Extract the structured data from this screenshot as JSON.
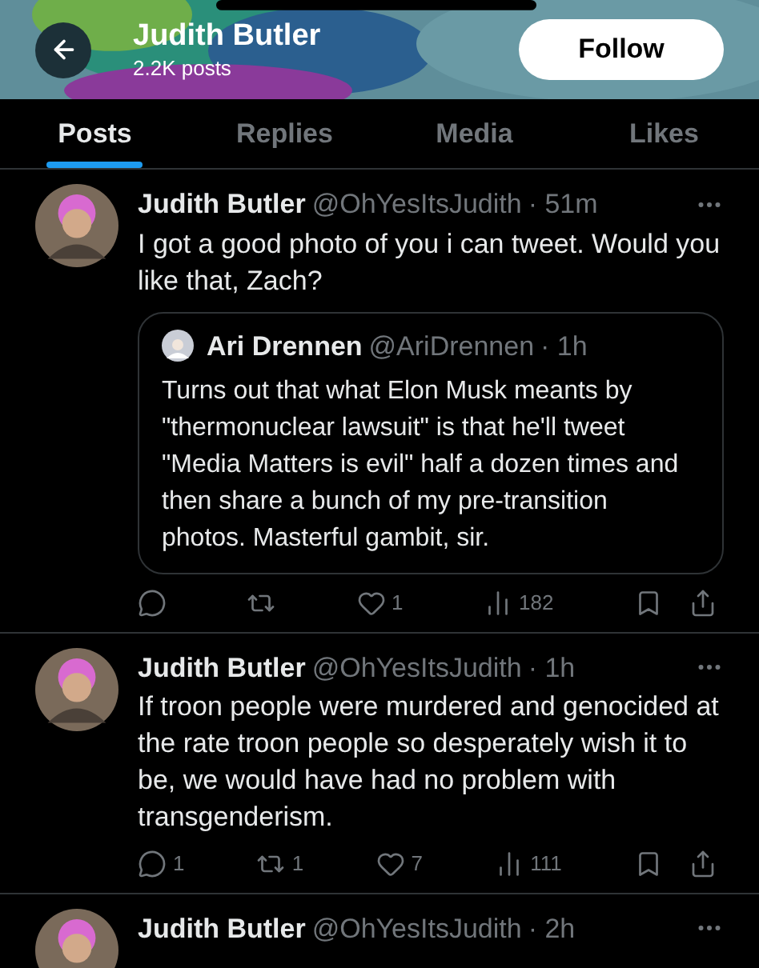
{
  "header": {
    "name": "Judith Butler",
    "post_count": "2.2K posts",
    "follow_label": "Follow"
  },
  "tabs": [
    {
      "label": "Posts",
      "selected": true
    },
    {
      "label": "Replies",
      "selected": false
    },
    {
      "label": "Media",
      "selected": false
    },
    {
      "label": "Likes",
      "selected": false
    }
  ],
  "posts": [
    {
      "author": "Judith Butler",
      "handle": "@OhYesItsJudith",
      "time": "· 51m",
      "text": "I got a good photo of you i can tweet. Would you like that, Zach?",
      "quote": {
        "author": "Ari Drennen",
        "handle": "@AriDrennen",
        "time": "· 1h",
        "text": "Turns out that what Elon Musk meants by \"thermonuclear lawsuit\" is that he'll tweet \"Media Matters is evil\" half a dozen times and then share a bunch of my pre-transition photos. Masterful gambit, sir."
      },
      "likes": "1",
      "views": "182"
    },
    {
      "author": "Judith Butler",
      "handle": "@OhYesItsJudith",
      "time": "· 1h",
      "text": "If troon people were murdered and genocided at the rate troon people so desperately wish it to be, we would have had no problem with transgenderism.",
      "replies": "1",
      "reposts": "1",
      "likes": "7",
      "views": "111"
    },
    {
      "author": "Judith Butler",
      "handle": "@OhYesItsJudith",
      "time": "· 2h"
    }
  ]
}
